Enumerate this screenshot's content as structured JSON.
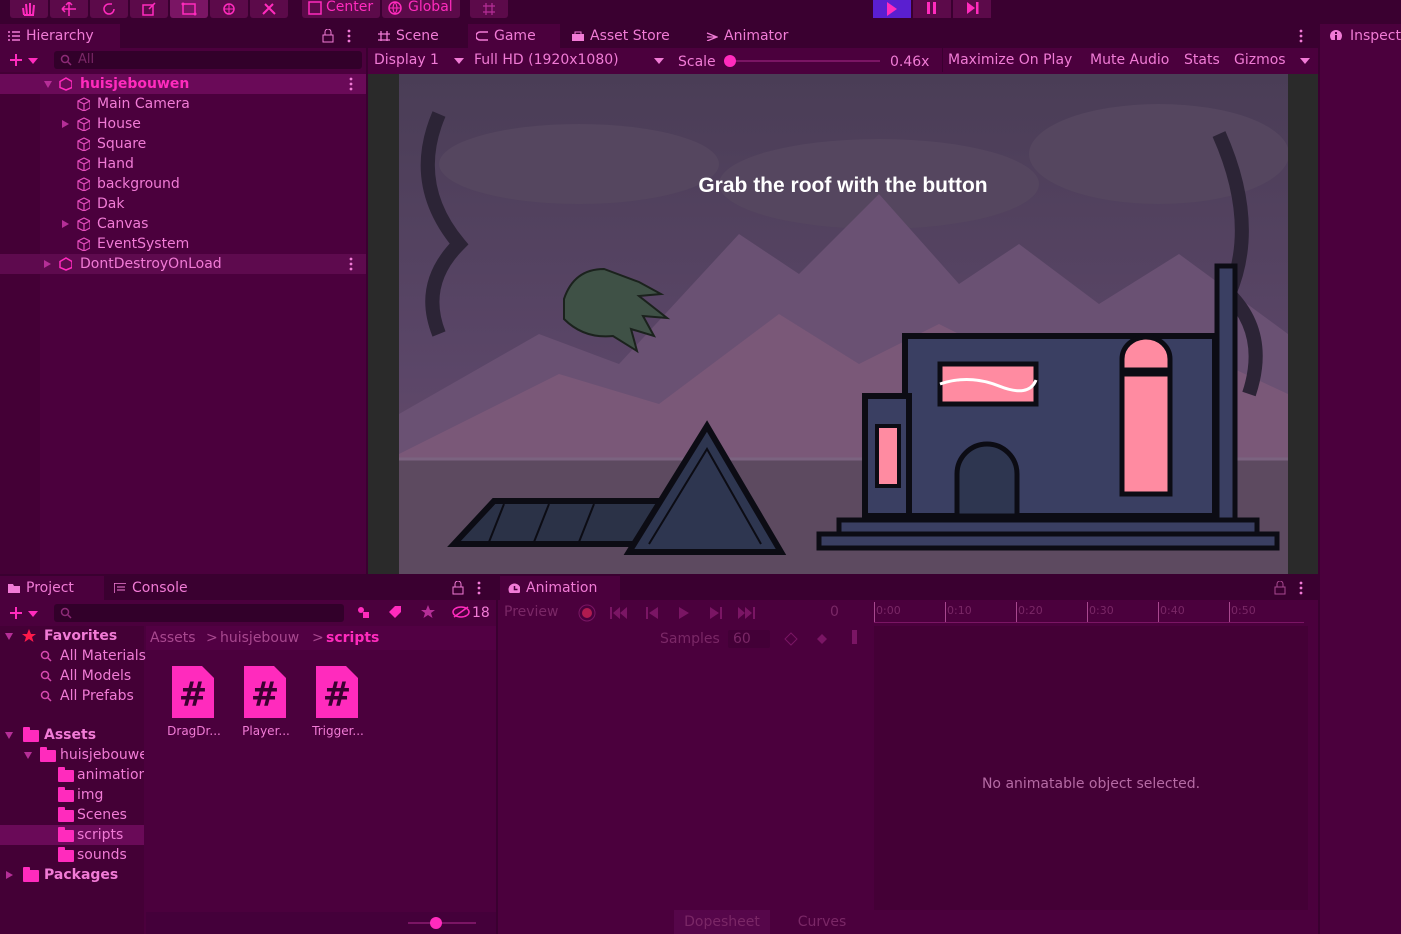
{
  "toolbar": {
    "tools": [
      "hand-tool",
      "move-tool",
      "rotate-tool",
      "scale-tool",
      "rect-tool",
      "transform-tool",
      "custom-tool"
    ],
    "pivot_label": "Center",
    "space_label": "Global"
  },
  "hierarchy": {
    "tab_label": "Hierarchy",
    "search_placeholder": "All",
    "scene_name": "huisjebouwen",
    "items": [
      {
        "label": "Main Camera"
      },
      {
        "label": "House"
      },
      {
        "label": "Square"
      },
      {
        "label": "Hand"
      },
      {
        "label": "background"
      },
      {
        "label": "Dak"
      },
      {
        "label": "Canvas"
      },
      {
        "label": "EventSystem"
      }
    ],
    "ddol_name": "DontDestroyOnLoad"
  },
  "center_tabs": {
    "scene": "Scene",
    "game": "Game",
    "asset_store": "Asset Store",
    "animator": "Animator"
  },
  "game_toolbar": {
    "display": "Display 1",
    "resolution": "Full HD (1920x1080)",
    "scale_label": "Scale",
    "scale_value": "0.46x",
    "scale_fraction": 0.0,
    "maximize": "Maximize On Play",
    "mute": "Mute Audio",
    "stats": "Stats",
    "gizmos": "Gizmos"
  },
  "game_view": {
    "prompt_text": "Grab the roof with the button"
  },
  "inspector": {
    "tab_label": "Inspector"
  },
  "project": {
    "tab_project": "Project",
    "tab_console": "Console",
    "hidden_count": "18",
    "favorites_label": "Favorites",
    "favorites": [
      "All Materials",
      "All Models",
      "All Prefabs"
    ],
    "assets_label": "Assets",
    "assets_child": "huisjebouwen",
    "subfolders": [
      "animation",
      "img",
      "Scenes",
      "scripts",
      "sounds"
    ],
    "packages_label": "Packages",
    "breadcrumb": [
      "Assets",
      "huisjebouw",
      "scripts"
    ],
    "files": [
      "DragDr...",
      "Player...",
      "Trigger..."
    ]
  },
  "animation": {
    "tab_label": "Animation",
    "preview_label": "Preview",
    "frame_value": "0",
    "samples_label": "Samples",
    "samples_value": "60",
    "timeline_ticks": [
      "0:00",
      "0:10",
      "0:20",
      "0:30",
      "0:40",
      "0:50"
    ],
    "empty_message": "No animatable object selected.",
    "dopesheet_tab": "Dopesheet",
    "curves_tab": "Curves"
  },
  "colors": {
    "accent": "#ff2bbd",
    "panel": "#4b003d",
    "background": "#3a0030",
    "play_active": "#5a1fd0",
    "text": "#f17bd6"
  }
}
